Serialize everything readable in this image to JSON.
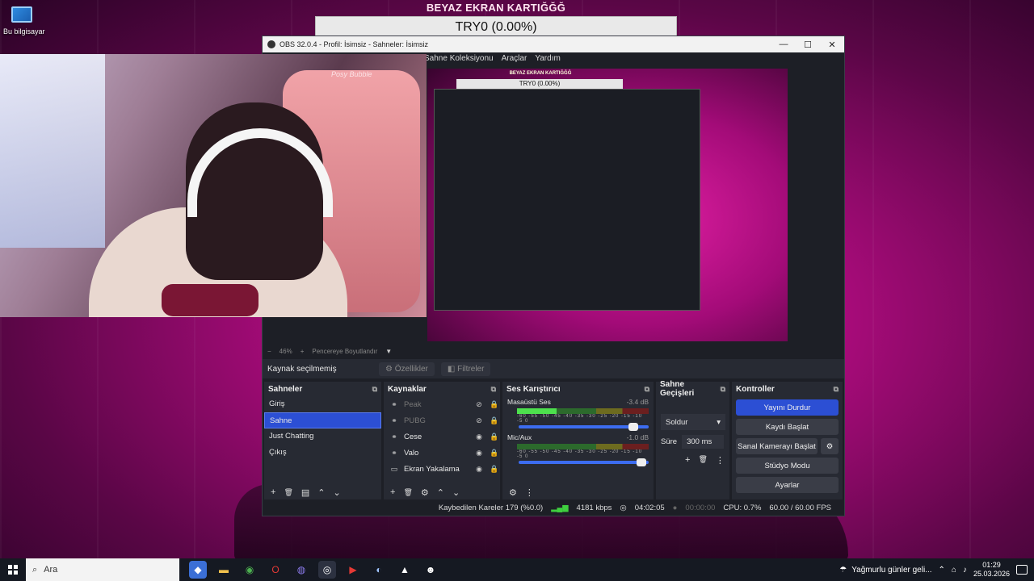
{
  "desktop": {
    "icon_label": "Bu bilgisayar"
  },
  "banner": {
    "title": "BEYAZ EKRAN KARTIĞĞĞ",
    "progress_text": "TRY0 (0.00%)"
  },
  "obs": {
    "title": "OBS 32.0.4 - Profil: İsimsiz - Sahneler: İsimsiz",
    "window_buttons": {
      "minimize": "—",
      "maximize": "☐",
      "close": "✕"
    },
    "menu": [
      "Sahne Koleksiyonu",
      "Araçlar",
      "Yardım"
    ],
    "preview": {
      "inner_title": "BEYAZ EKRAN KARTIĞĞĞ",
      "inner_progress": "TRY0 (0.00%)"
    },
    "zoom": {
      "minus": "−",
      "level": "46%",
      "plus": "+",
      "fit_label": "Pencereye Boyutlandır",
      "fit_arrow": "▼"
    },
    "source_bar": {
      "no_source": "Kaynak seçilmemiş",
      "properties": "Özellikler",
      "filters": "Filtreler"
    },
    "scenes": {
      "title": "Sahneler",
      "items": [
        "Giriş",
        "Sahne",
        "Just Chatting",
        "Çıkış"
      ],
      "selected_index": 1,
      "footer": {
        "add": "+",
        "remove": "🗑",
        "filter": "▤",
        "up": "⌃",
        "down": "⌄"
      }
    },
    "sources": {
      "title": "Kaynaklar",
      "items": [
        {
          "label": "Peak",
          "type": "link-icon",
          "visible": false
        },
        {
          "label": "PUBG",
          "type": "link-icon",
          "visible": false
        },
        {
          "label": "Cese",
          "type": "link-icon",
          "visible": true
        },
        {
          "label": "Valo",
          "type": "link-icon",
          "visible": true
        },
        {
          "label": "Ekran Yakalama",
          "type": "monitor-icon",
          "visible": true
        }
      ],
      "footer": {
        "add": "+",
        "remove": "🗑",
        "settings": "⚙",
        "up": "⌃",
        "down": "⌄"
      }
    },
    "mixer": {
      "title": "Ses Karıştırıcı",
      "channels": [
        {
          "name": "Masaüstü Ses",
          "db": "-3.4 dB",
          "level": 0.3,
          "volume": 0.92
        },
        {
          "name": "Mic/Aux",
          "db": "-1.0 dB",
          "level": 0.0,
          "volume": 0.98
        }
      ],
      "scale": "-60 -55 -50 -45 -40 -35 -30 -25 -20 -15 -10 -5 0",
      "footer": {
        "advanced": "⚙",
        "menu": "⋮"
      }
    },
    "transitions": {
      "title": "Sahne Geçişleri",
      "selected": "Soldur",
      "duration_label": "Süre",
      "duration_value": "300 ms",
      "tools": {
        "add": "+",
        "remove": "🗑",
        "menu": "⋮"
      }
    },
    "controls": {
      "title": "Kontroller",
      "buttons": {
        "stream": "Yayını Durdur",
        "record": "Kaydı Başlat",
        "virtual_cam": "Sanal Kamerayı Başlat",
        "studio": "Stüdyo Modu",
        "settings": "Ayarlar"
      }
    },
    "status": {
      "dropped": "Kaybedilen Kareler 179 (%0.0)",
      "bitrate": "4181 kbps",
      "stream_time": "04:02:05",
      "record_time": "00:00:00",
      "cpu": "CPU: 0.7%",
      "fps": "60.00 / 60.00 FPS"
    }
  },
  "webcam": {
    "brand": "Posy Bubble"
  },
  "taskbar": {
    "search_placeholder": "Ara",
    "weather": "Yağmurlu günler geli...",
    "time": "01:29",
    "date": "25.03.2026"
  },
  "colors": {
    "accent": "#2c4fd4",
    "background": "#b10c80"
  }
}
